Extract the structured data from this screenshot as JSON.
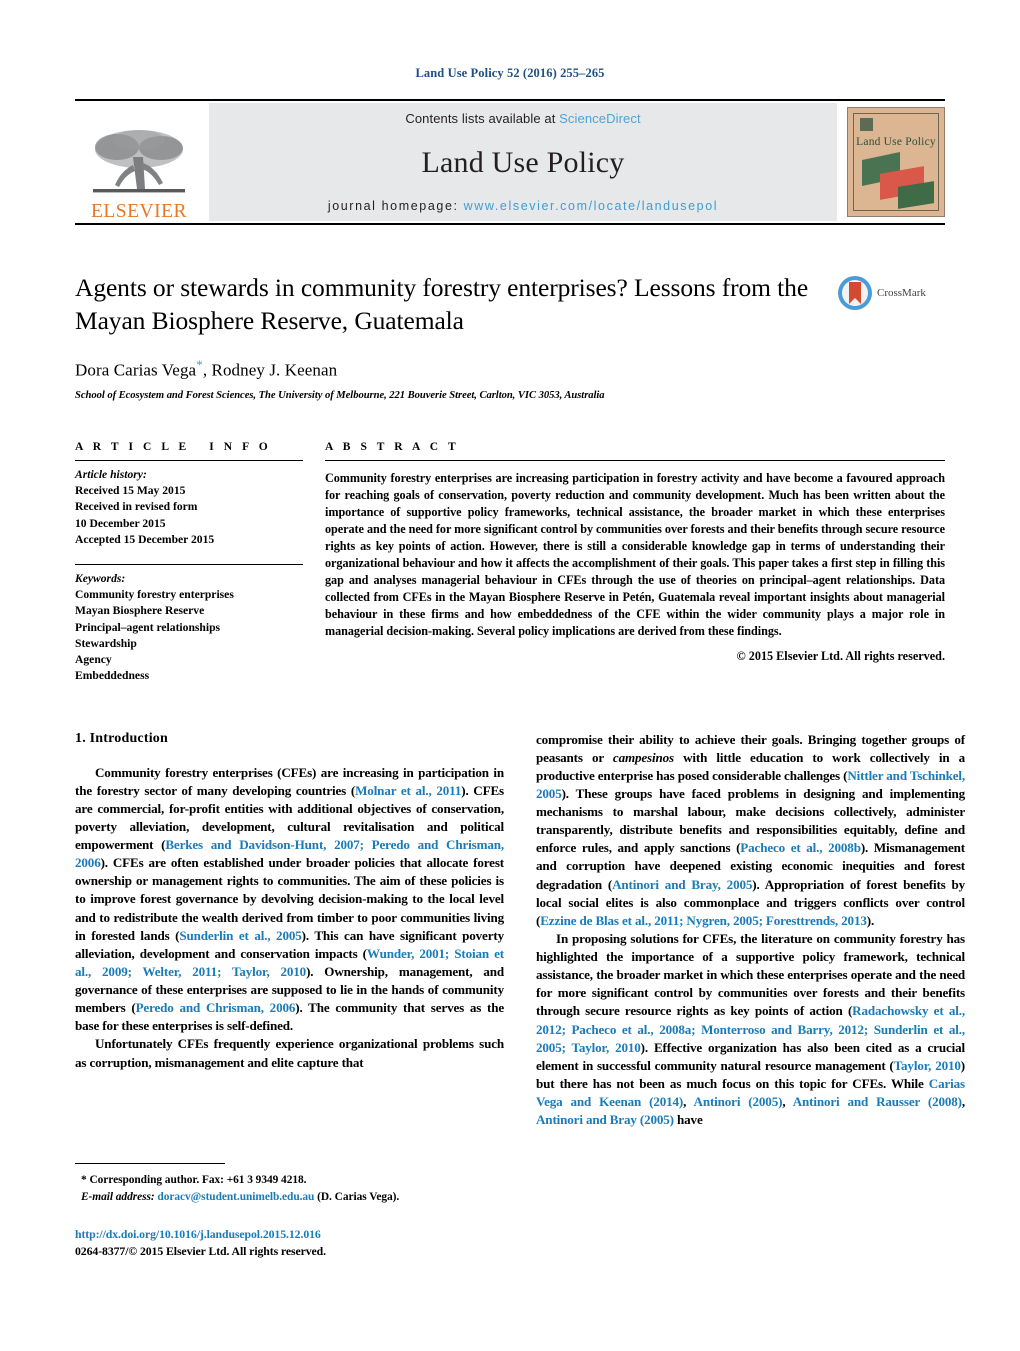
{
  "running_head": "Land Use Policy 52 (2016) 255–265",
  "masthead": {
    "publisher_name": "ELSEVIER",
    "contents_prefix": "Contents lists available at ",
    "contents_link": "ScienceDirect",
    "journal_title": "Land Use Policy",
    "homepage_prefix": "journal homepage: ",
    "homepage_url": "www.elsevier.com/locate/landusepol",
    "cover_title": "Land Use Policy"
  },
  "article": {
    "title": "Agents or stewards in community forestry enterprises? Lessons from the Mayan Biosphere Reserve, Guatemala",
    "authors": "Dora Carias Vega",
    "authors_rest": ", Rodney J. Keenan",
    "corresponding_marker": "*",
    "affiliation": "School of Ecosystem and Forest Sciences, The University of Melbourne, 221 Bouverie Street, Carlton, VIC 3053, Australia",
    "crossmark_label": "CrossMark"
  },
  "article_info": {
    "heading": "ARTICLE INFO",
    "history_label": "Article history:",
    "history": [
      "Received 15 May 2015",
      "Received in revised form",
      "10 December 2015",
      "Accepted 15 December 2015"
    ],
    "keywords_label": "Keywords:",
    "keywords": [
      "Community forestry enterprises",
      "Mayan Biosphere Reserve",
      "Principal–agent relationships",
      "Stewardship",
      "Agency",
      "Embeddedness"
    ]
  },
  "abstract": {
    "heading": "ABSTRACT",
    "text": "Community forestry enterprises are increasing participation in forestry activity and have become a favoured approach for reaching goals of conservation, poverty reduction and community development. Much has been written about the importance of supportive policy frameworks, technical assistance, the broader market in which these enterprises operate and the need for more significant control by communities over forests and their benefits through secure resource rights as key points of action. However, there is still a considerable knowledge gap in terms of understanding their organizational behaviour and how it affects the accomplishment of their goals. This paper takes a first step in filling this gap and analyses managerial behaviour in CFEs through the use of theories on principal–agent relationships. Data collected from CFEs in the Mayan Biosphere Reserve in Petén, Guatemala reveal important insights about managerial behaviour in these firms and how embeddedness of the CFE within the wider community plays a major role in managerial decision-making. Several policy implications are derived from these findings.",
    "copyright": "© 2015 Elsevier Ltd. All rights reserved."
  },
  "body": {
    "section_number_title": "1. Introduction",
    "left_paragraphs": [
      {
        "runs": [
          {
            "t": "Community forestry enterprises (CFEs) are increasing in participation in the forestry sector of many developing countries ("
          },
          {
            "t": "Molnar et al., 2011",
            "cite": true
          },
          {
            "t": "). CFEs are commercial, for-profit entities with additional objectives of conservation, poverty alleviation, development, cultural revitalisation and political empowerment ("
          },
          {
            "t": "Berkes and Davidson-Hunt, 2007; Peredo and Chrisman, 2006",
            "cite": true
          },
          {
            "t": "). CFEs are often established under broader policies that allocate forest ownership or management rights to communities. The aim of these policies is to improve forest governance by devolving decision-making to the local level and to redistribute the wealth derived from timber to poor communities living in forested lands ("
          },
          {
            "t": "Sunderlin et al., 2005",
            "cite": true
          },
          {
            "t": "). This can have significant poverty alleviation, development and conservation impacts ("
          },
          {
            "t": "Wunder, 2001; Stoian et al., 2009; Welter, 2011; Taylor, 2010",
            "cite": true
          },
          {
            "t": "). Ownership, management, and governance of these enterprises are supposed to lie in the hands of community members ("
          },
          {
            "t": "Peredo and Chrisman, 2006",
            "cite": true
          },
          {
            "t": "). The community that serves as the base for these enterprises is self-defined."
          }
        ]
      },
      {
        "runs": [
          {
            "t": "Unfortunately CFEs frequently experience organizational problems such as corruption, mismanagement and elite capture that"
          }
        ]
      }
    ],
    "right_paragraphs": [
      {
        "no_indent": true,
        "runs": [
          {
            "t": "compromise their ability to achieve their goals. Bringing together groups of peasants or "
          },
          {
            "t": "campesinos",
            "italic": true
          },
          {
            "t": " with little education to work collectively in a productive enterprise has posed considerable challenges ("
          },
          {
            "t": "Nittler and Tschinkel, 2005",
            "cite": true
          },
          {
            "t": "). These groups have faced problems in designing and implementing mechanisms to marshal labour, make decisions collectively, administer transparently, distribute benefits and responsibilities equitably, define and enforce rules, and apply sanctions ("
          },
          {
            "t": "Pacheco et al., 2008b",
            "cite": true
          },
          {
            "t": "). Mismanagement and corruption have deepened existing economic inequities and forest degradation ("
          },
          {
            "t": "Antinori and Bray, 2005",
            "cite": true
          },
          {
            "t": "). Appropriation of forest benefits by local social elites is also commonplace and triggers conflicts over control ("
          },
          {
            "t": "Ezzine de Blas et al., 2011; Nygren, 2005; Foresttrends, 2013",
            "cite": true
          },
          {
            "t": ")."
          }
        ]
      },
      {
        "runs": [
          {
            "t": "In proposing solutions for CFEs, the literature on community forestry has highlighted the importance of a supportive policy framework, technical assistance, the broader market in which these enterprises operate and the need for more significant control by communities over forests and their benefits through secure resource rights as key points of action ("
          },
          {
            "t": "Radachowsky et al., 2012; Pacheco et al., 2008a; Monterroso and Barry, 2012; Sunderlin et al., 2005; Taylor, 2010",
            "cite": true
          },
          {
            "t": "). Effective organization has also been cited as a crucial element in successful community natural resource management ("
          },
          {
            "t": "Taylor, 2010",
            "cite": true
          },
          {
            "t": ") but there has not been as much focus on this topic for CFEs. While "
          },
          {
            "t": "Carias Vega and Keenan (2014)",
            "cite": true
          },
          {
            "t": ", "
          },
          {
            "t": "Antinori (2005)",
            "cite": true
          },
          {
            "t": ", "
          },
          {
            "t": "Antinori and Rausser (2008)",
            "cite": true
          },
          {
            "t": ", "
          },
          {
            "t": "Antinori and Bray (2005)",
            "cite": true
          },
          {
            "t": " have"
          }
        ]
      }
    ]
  },
  "footnote": {
    "corresponding": "* Corresponding author. Fax: +61 3 9349 4218.",
    "email_label": "E-mail address: ",
    "email": "doracv@student.unimelb.edu.au",
    "email_suffix": " (D. Carias Vega).",
    "doi": "http://dx.doi.org/10.1016/j.landusepol.2015.12.016",
    "issn": "0264-8377/© 2015 Elsevier Ltd. All rights reserved."
  },
  "colors": {
    "link": "#1a7bb9",
    "running_head": "#1f4f82",
    "elsevier_orange": "#E87722",
    "band_bg": "#e7e8e9"
  }
}
